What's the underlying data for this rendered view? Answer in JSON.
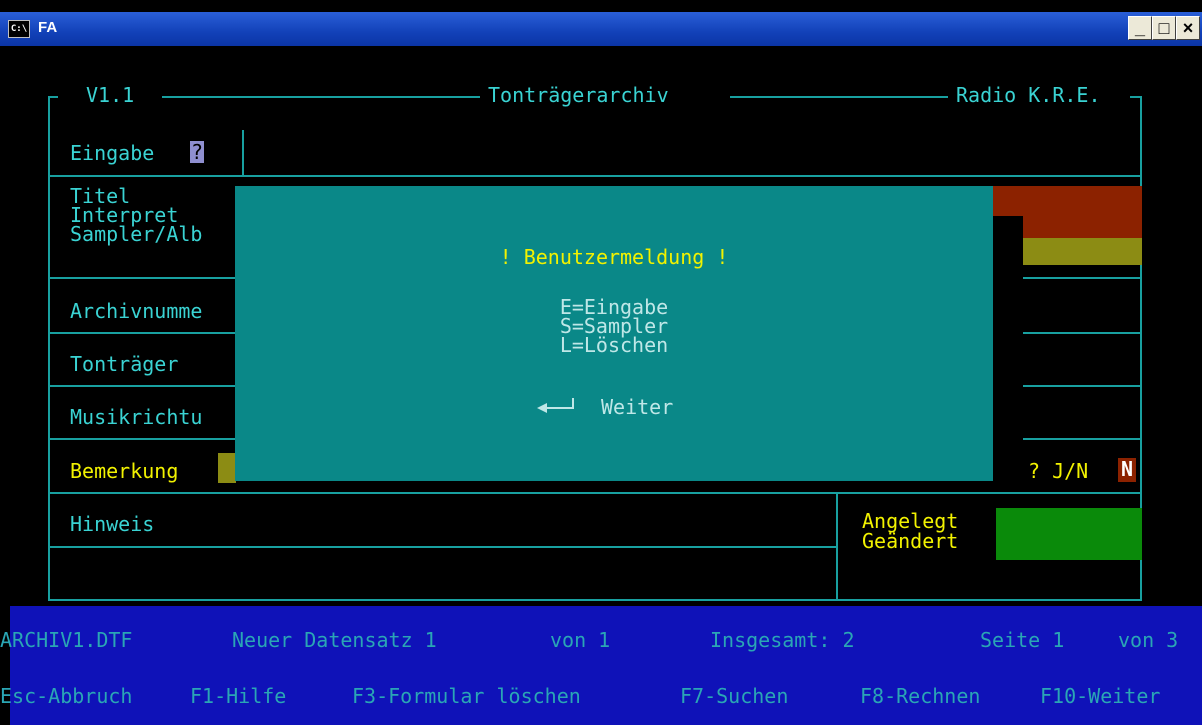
{
  "window": {
    "title": "FA",
    "console_icon": "C:\\",
    "minimize": "_",
    "maximize": "□",
    "close": "×"
  },
  "header": {
    "version": "V1.1",
    "app_title": "Tonträgerarchiv",
    "station": "Radio K.R.E."
  },
  "form": {
    "eingabe_label": "Eingabe",
    "eingabe_cursor": "?",
    "titel_label": "Titel",
    "interpret_label": "Interpret",
    "sampler_label": "Sampler/Alb",
    "archivnummer_label": "Archivnumme",
    "tontraeger_label": "Tonträger",
    "musikrichtung_label": "Musikrichtu",
    "bemerkung_label": "Bemerkung",
    "jn_prompt": "? J/N",
    "jn_value": "N",
    "hinweis_label": "Hinweis",
    "angelegt_label": "Angelegt",
    "geaendert_label": "Geändert"
  },
  "dialog": {
    "title": "! Benutzermeldung !",
    "options": [
      "E=Eingabe",
      "S=Sampler",
      "L=Löschen"
    ],
    "continue_icon": "enter-arrow-icon",
    "continue_label": "Weiter"
  },
  "status": {
    "filename": "ARCHIV1.DTF",
    "record": "Neuer Datensatz 1",
    "record_of": "von 1",
    "total": "Insgesamt: 2",
    "page": "Seite 1",
    "page_of": "von 3"
  },
  "function_keys": [
    "Esc-Abbruch",
    "F1-Hilfe",
    "F3-Formular löschen",
    "F7-Suchen",
    "F8-Rechnen",
    "F10-Weiter"
  ],
  "colors": {
    "console_bg": "#000000",
    "frame": "#18a0a0",
    "label": "#3ad3d3",
    "dialog_bg": "#0a8888",
    "dialog_title": "#f2f200",
    "status_bg": "#0f12b8",
    "field_red": "#8c2200",
    "field_olive": "#8c8c14",
    "field_green": "#0a8a0a"
  }
}
